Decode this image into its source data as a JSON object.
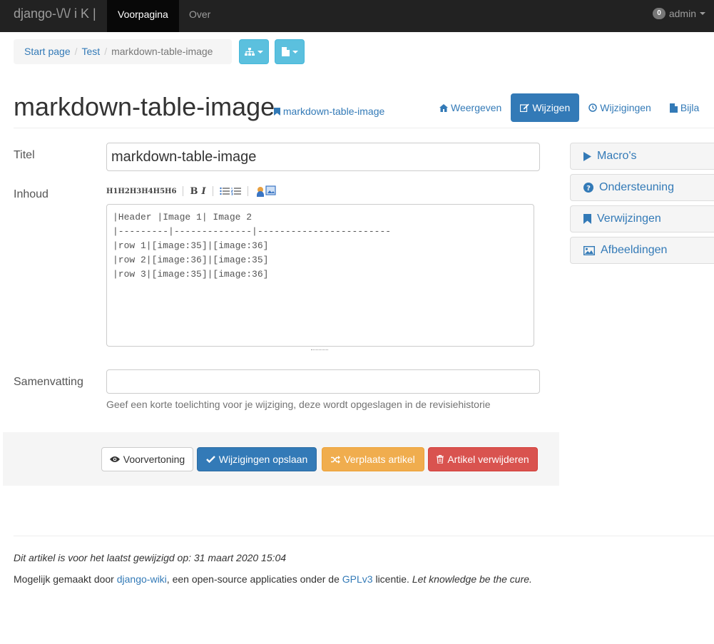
{
  "navbar": {
    "brand": "django-\\/\\/ i K |",
    "links": [
      {
        "label": "Voorpagina",
        "active": true
      },
      {
        "label": "Over",
        "active": false
      }
    ],
    "notification_count": "0",
    "user": "admin"
  },
  "breadcrumb": {
    "items": [
      "Start page",
      "Test"
    ],
    "current": "markdown-table-image",
    "buttons": [
      {
        "icon": "sitemap-icon"
      },
      {
        "icon": "file-icon"
      }
    ]
  },
  "article": {
    "title": "markdown-table-image",
    "slug_link": "markdown-table-image",
    "tabs": [
      {
        "label": "Weergeven",
        "icon": "home-icon",
        "active": false
      },
      {
        "label": "Wijzigen",
        "icon": "edit-icon",
        "active": true
      },
      {
        "label": "Wijzigingen",
        "icon": "clock-icon",
        "active": false
      },
      {
        "label": "Bijla",
        "icon": "file-icon",
        "active": false
      }
    ]
  },
  "form": {
    "title_label": "Titel",
    "title_value": "markdown-table-image",
    "content_label": "Inhoud",
    "toolbar": {
      "headings": [
        "H1",
        "H2",
        "H3",
        "H4",
        "H5",
        "H6"
      ],
      "bold": "B",
      "italic": "I"
    },
    "content_value": "|Header |Image 1| Image 2\n|---------|--------------|------------------------\n|row 1|[image:35]|[image:36]\n|row 2|[image:36]|[image:35]\n|row 3|[image:35]|[image:36]",
    "summary_label": "Samenvatting",
    "summary_value": "",
    "summary_help": "Geef een korte toelichting voor je wijziging, deze wordt opgeslagen in de revisiehistorie"
  },
  "actions": {
    "preview": "Voorvertoning",
    "save": "Wijzigingen opslaan",
    "move": "Verplaats artikel",
    "delete": "Artikel verwijderen"
  },
  "sidebar": {
    "panels": [
      {
        "label": "Macro's",
        "icon": "play-icon"
      },
      {
        "label": "Ondersteuning",
        "icon": "question-circle-icon"
      },
      {
        "label": "Verwijzingen",
        "icon": "bookmark-icon"
      },
      {
        "label": "Afbeeldingen",
        "icon": "image-icon"
      }
    ]
  },
  "footer": {
    "modified_text": "Dit artikel is voor het laatst gewijzigd op: 31 maart 2020 15:04",
    "credit_prefix": "Mogelijk gemaakt door ",
    "credit_link1": "django-wiki",
    "credit_middle": ", een open-source applicaties onder de ",
    "credit_link2": "GPLv3",
    "credit_suffix": " licentie. ",
    "credit_motto": "Let knowledge be the cure."
  },
  "colors": {
    "navbar": "#222222",
    "primary": "#337ab7",
    "info": "#5bc0de",
    "warning": "#f0ad4e",
    "danger": "#d9534f"
  }
}
